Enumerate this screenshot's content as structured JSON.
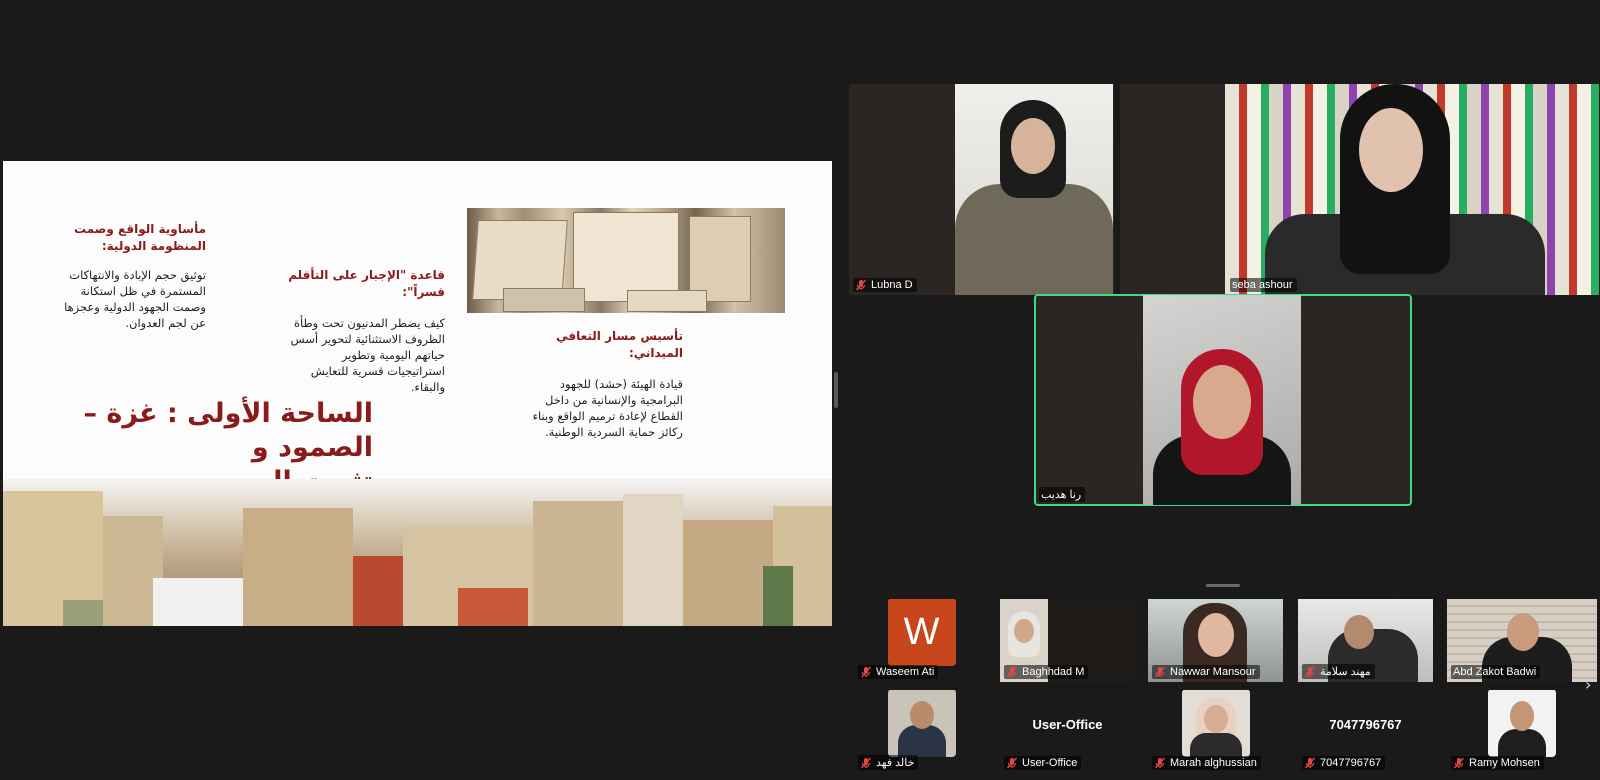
{
  "slide": {
    "block1_heading": "مأساوية الواقع وصمت المنظومة الدولية:",
    "block1_body": "توثيق حجم الإبادة والانتهاكات المستمرة في ظل استكانة وصمت الجهود الدولية وعجزها عن لجم العدوان.",
    "block2_heading": "قاعدة \"الإجبار على التأقلم قسراً\":",
    "block2_body": "كيف يضطر المدنيون تحت وطأة الظروف الاستثنائية لتحوير أسس حياتهم اليومية وتطوير استراتيجيات قسرية للتعايش والبقاء.",
    "block3_heading": "تأسيس مسار التعافي الميداني:",
    "block3_body": "قيادة الهيئة (حشد) للجهود البرامجية والإنسانية من داخل القطاع لإعادة ترميم الواقع وبناء ركائز حماية السردية الوطنية.",
    "title_line1": "الساحة الأولى : غزة – الصمود و",
    "title_line2": "تثبيت الوجود"
  },
  "participants_main": [
    {
      "name": "Lubna D"
    },
    {
      "name": "seba ashour"
    },
    {
      "name": "رنا هديب",
      "active_speaker": true
    }
  ],
  "participants_strip_row1": [
    {
      "name": "Waseem Ati",
      "avatar_letter": "W",
      "avatar_color": "#c7461b"
    },
    {
      "name": "Baghhdad M"
    },
    {
      "name": "Nawwar Mansour"
    },
    {
      "name": "مهند سلامة"
    },
    {
      "name": "Abd Zakot Badwi"
    }
  ],
  "participants_strip_row2": [
    {
      "name": "خالد فهد"
    },
    {
      "name": "User-Office",
      "display_label": "User-Office"
    },
    {
      "name": "Marah alghussian"
    },
    {
      "name": "7047796767",
      "display_label": "7047796767"
    },
    {
      "name": "Ramy Mohsen"
    }
  ],
  "icons": {
    "muted_mic": "mic-muted-icon",
    "next_page": "chevron-right-icon"
  },
  "colors": {
    "background": "#1a1a1a",
    "active_speaker_border": "#3ddc84",
    "muted_mic": "#e04646",
    "slide_heading": "#8b1a1a"
  },
  "strip_next_glyph": "›"
}
